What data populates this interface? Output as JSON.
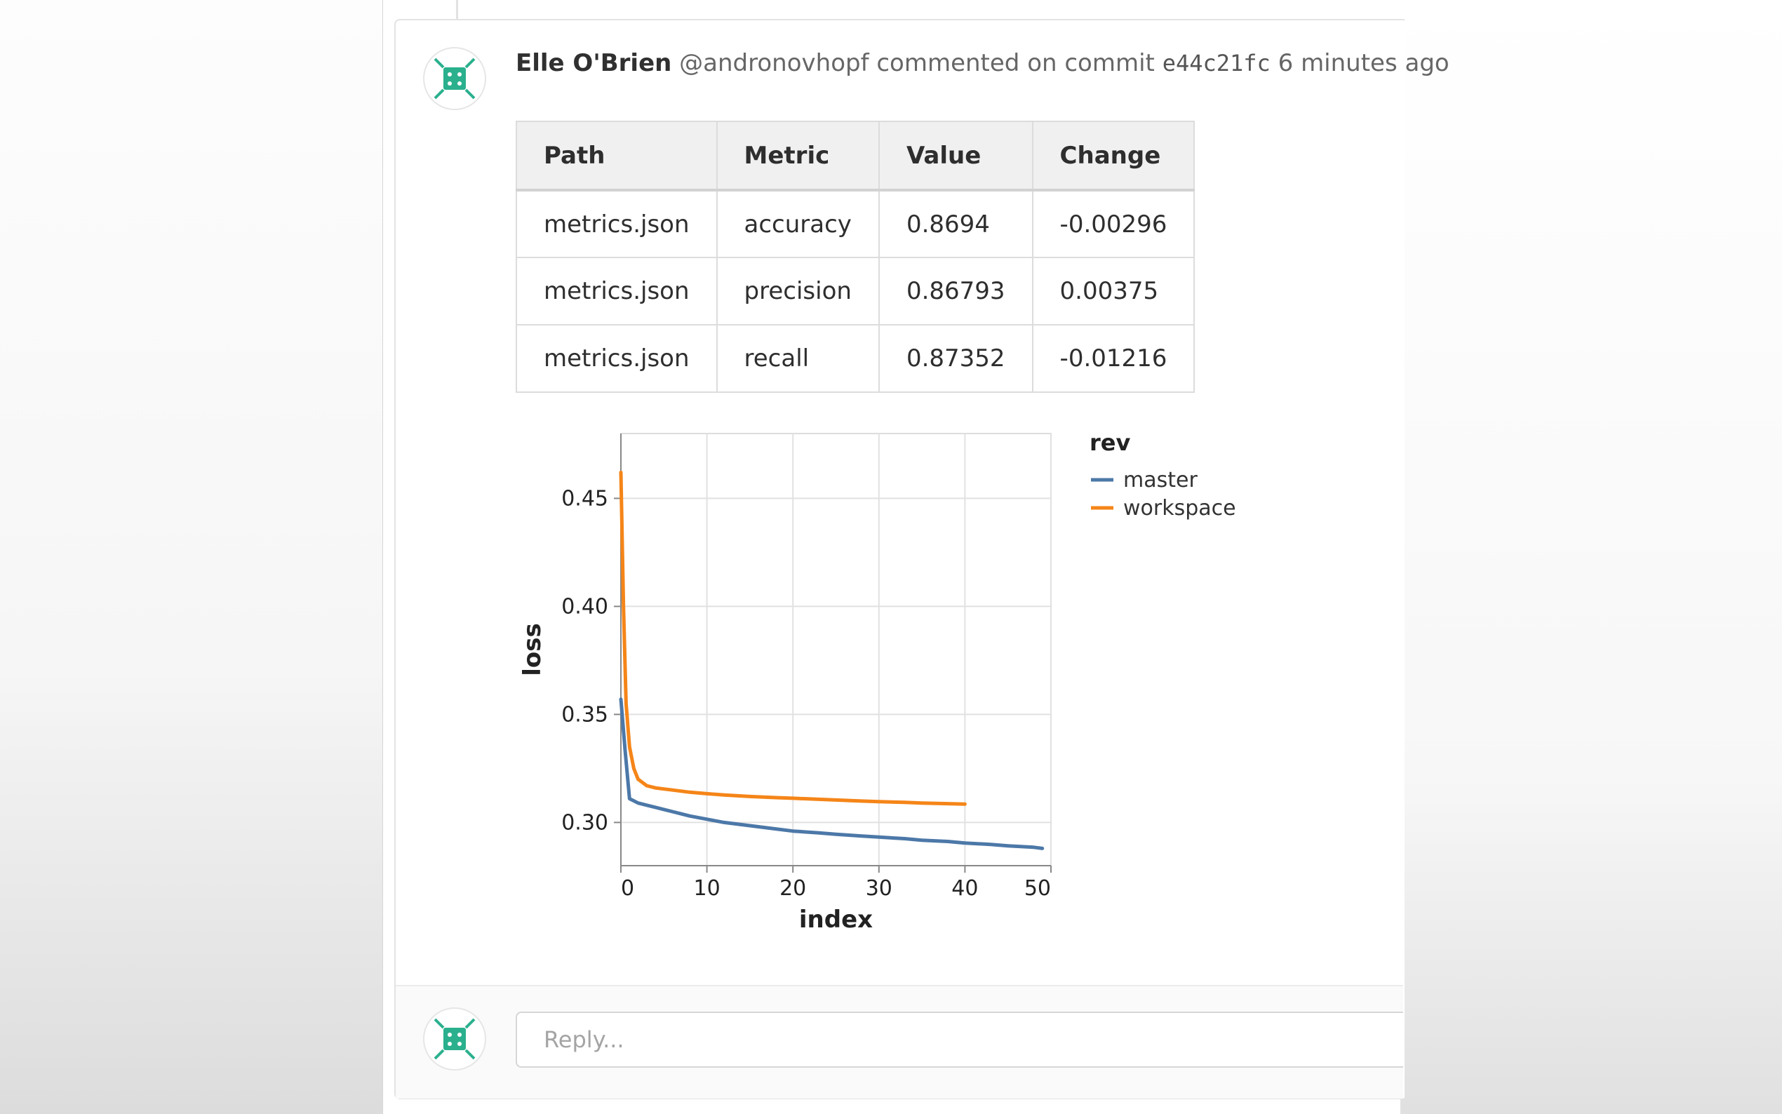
{
  "comment": {
    "author": "Elle O'Brien",
    "handle": "@andronovhopf",
    "action": "commented on commit",
    "commit_sha": "e44c21fc",
    "time_ago": "6 minutes ago"
  },
  "metrics_table": {
    "headers": [
      "Path",
      "Metric",
      "Value",
      "Change"
    ],
    "rows": [
      [
        "metrics.json",
        "accuracy",
        "0.8694",
        "-0.00296"
      ],
      [
        "metrics.json",
        "precision",
        "0.86793",
        "0.00375"
      ],
      [
        "metrics.json",
        "recall",
        "0.87352",
        "-0.01216"
      ]
    ]
  },
  "chart_data": {
    "type": "line",
    "title": "",
    "xlabel": "index",
    "ylabel": "loss",
    "xlim": [
      0,
      50
    ],
    "ylim": [
      0.28,
      0.48
    ],
    "xticks": [
      0,
      10,
      20,
      30,
      40,
      50
    ],
    "yticks": [
      0.3,
      0.35,
      0.4,
      0.45
    ],
    "grid": true,
    "legend": {
      "title": "rev",
      "position": "right"
    },
    "series": [
      {
        "name": "master",
        "color": "#4c78a8",
        "x": [
          0,
          0.5,
          1,
          2,
          3,
          4,
          5,
          6,
          7,
          8,
          10,
          12,
          15,
          18,
          20,
          23,
          25,
          28,
          30,
          33,
          35,
          38,
          40,
          43,
          45,
          48,
          49
        ],
        "y": [
          0.357,
          0.333,
          0.311,
          0.309,
          0.308,
          0.307,
          0.306,
          0.305,
          0.304,
          0.303,
          0.3015,
          0.3,
          0.2985,
          0.297,
          0.296,
          0.2952,
          0.2945,
          0.2937,
          0.2932,
          0.2925,
          0.2918,
          0.2912,
          0.2905,
          0.2898,
          0.2892,
          0.2885,
          0.288
        ]
      },
      {
        "name": "workspace",
        "color": "#f58518",
        "x": [
          0,
          0.3,
          0.6,
          1,
          1.5,
          2,
          3,
          4,
          5,
          6,
          8,
          10,
          12,
          15,
          18,
          20,
          23,
          25,
          28,
          30,
          33,
          35,
          38,
          40
        ],
        "y": [
          0.462,
          0.4,
          0.355,
          0.335,
          0.325,
          0.32,
          0.317,
          0.316,
          0.3155,
          0.315,
          0.314,
          0.3133,
          0.3127,
          0.312,
          0.3115,
          0.3112,
          0.3107,
          0.3104,
          0.3099,
          0.3096,
          0.3093,
          0.309,
          0.3087,
          0.3085
        ]
      }
    ]
  },
  "reply": {
    "placeholder": "Reply..."
  },
  "colors": {
    "avatar_green": "#2bb08e",
    "avatar_dark": "#1f8a6f"
  }
}
